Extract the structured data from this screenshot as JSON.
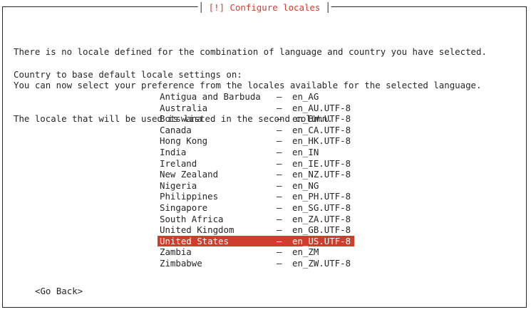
{
  "dialog": {
    "title": "[!] Configure locales",
    "description_lines": [
      "There is no locale defined for the combination of language and country you have selected.",
      "You can now select your preference from the locales available for the selected language.",
      "The locale that will be used is listed in the second column."
    ],
    "prompt": "Country to base default locale settings on:",
    "separator": "–",
    "locales": [
      {
        "country": "Antigua and Barbuda",
        "locale": "en_AG"
      },
      {
        "country": "Australia",
        "locale": "en_AU.UTF-8"
      },
      {
        "country": "Botswana",
        "locale": "en_BW.UTF-8"
      },
      {
        "country": "Canada",
        "locale": "en_CA.UTF-8"
      },
      {
        "country": "Hong Kong",
        "locale": "en_HK.UTF-8"
      },
      {
        "country": "India",
        "locale": "en_IN"
      },
      {
        "country": "Ireland",
        "locale": "en_IE.UTF-8"
      },
      {
        "country": "New Zealand",
        "locale": "en_NZ.UTF-8"
      },
      {
        "country": "Nigeria",
        "locale": "en_NG"
      },
      {
        "country": "Philippines",
        "locale": "en_PH.UTF-8"
      },
      {
        "country": "Singapore",
        "locale": "en_SG.UTF-8"
      },
      {
        "country": "South Africa",
        "locale": "en_ZA.UTF-8"
      },
      {
        "country": "United Kingdom",
        "locale": "en_GB.UTF-8"
      },
      {
        "country": "United States",
        "locale": "en_US.UTF-8"
      },
      {
        "country": "Zambia",
        "locale": "en_ZM"
      },
      {
        "country": "Zimbabwe",
        "locale": "en_ZW.UTF-8"
      }
    ],
    "selected_country": "United States",
    "go_back_label": "<Go Back>"
  },
  "colors": {
    "accent": "#cf3d2e",
    "text": "#262626",
    "background": "#ffffff"
  }
}
